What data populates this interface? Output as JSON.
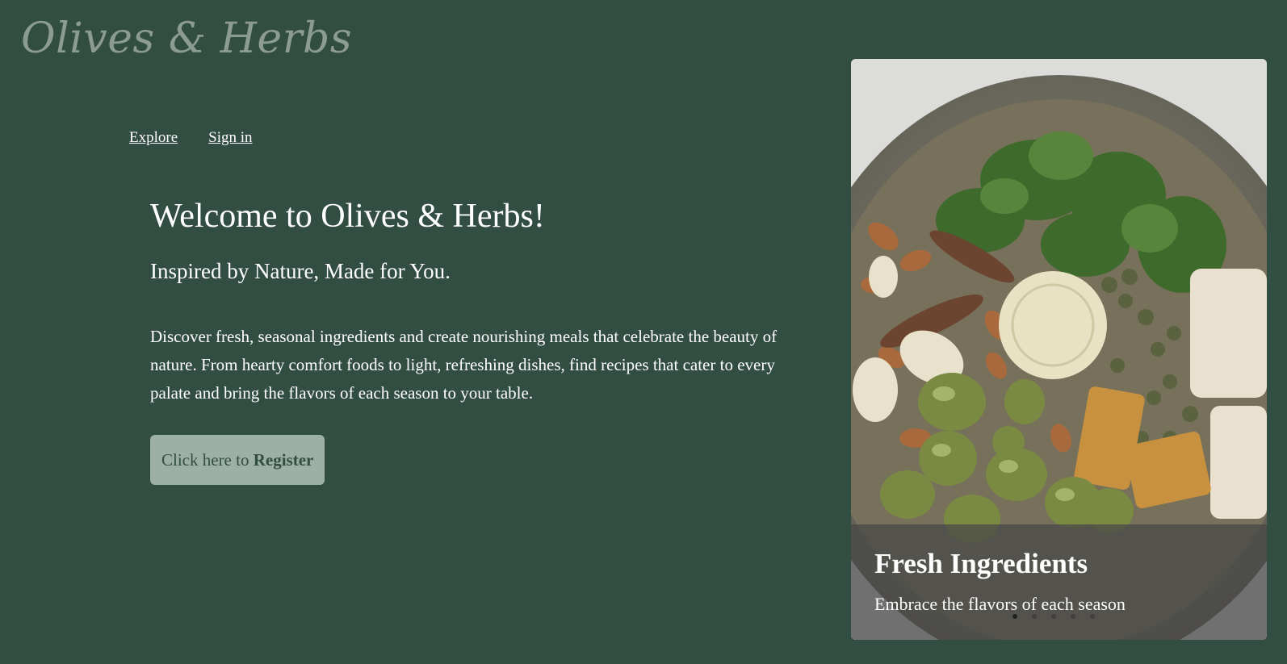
{
  "brand": {
    "logo_text": "Olives & Herbs"
  },
  "nav": {
    "explore": "Explore",
    "sign_in": "Sign in"
  },
  "hero": {
    "title": "Welcome to Olives & Herbs!",
    "subtitle": "Inspired by Nature, Made for You.",
    "description": "Discover fresh, seasonal ingredients and create nourishing meals that celebrate the beauty of nature. From hearty comfort foods to light, refreshing dishes, find recipes that cater to every palate and bring the flavors of each season to your table.",
    "register_prefix": "Click here to ",
    "register_bold": "Register"
  },
  "carousel": {
    "caption_title": "Fresh Ingredients",
    "caption_text": "Embrace the flavors of each season",
    "slide_count": 5,
    "active_slide": 1
  },
  "colors": {
    "background": "#324d42",
    "logo": "#8c9c91",
    "button_bg": "#9db0a5",
    "button_text": "#324d42"
  }
}
